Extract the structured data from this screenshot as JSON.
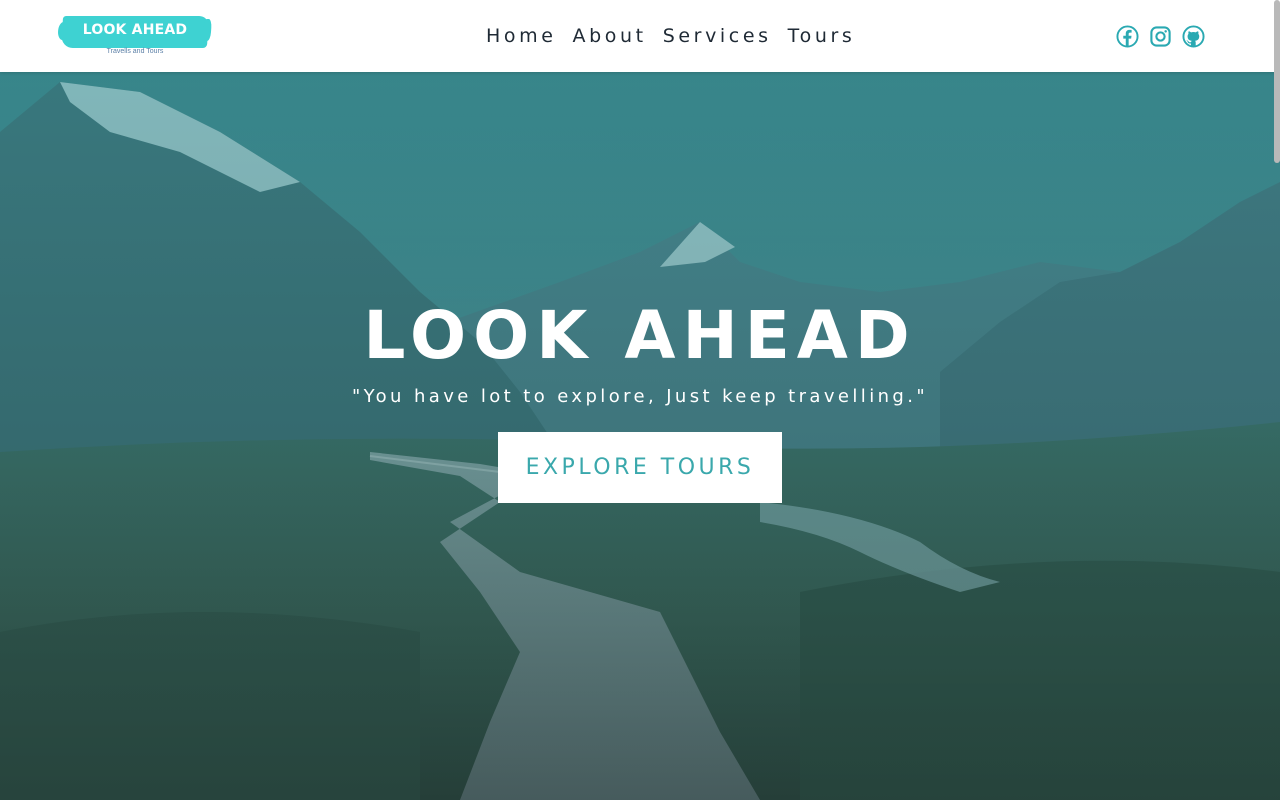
{
  "header": {
    "logo": {
      "title": "LOOK AHEAD",
      "subtitle": "Travells and Tours"
    },
    "nav": [
      {
        "label": "Home"
      },
      {
        "label": "About"
      },
      {
        "label": "Services"
      },
      {
        "label": "Tours"
      }
    ],
    "social": [
      {
        "icon": "facebook-icon"
      },
      {
        "icon": "instagram-icon"
      },
      {
        "icon": "github-icon"
      }
    ]
  },
  "hero": {
    "title": "LOOK AHEAD",
    "tagline": "\"You have lot to explore, Just keep travelling.\"",
    "button_label": "EXPLORE TOURS",
    "background": "mountain-valley-boardwalk-photo"
  },
  "colors": {
    "accent": "#3ed2d2",
    "icon": "#2aa9b2",
    "button_text": "#3aa8ac",
    "nav_text": "#1f2a35"
  }
}
